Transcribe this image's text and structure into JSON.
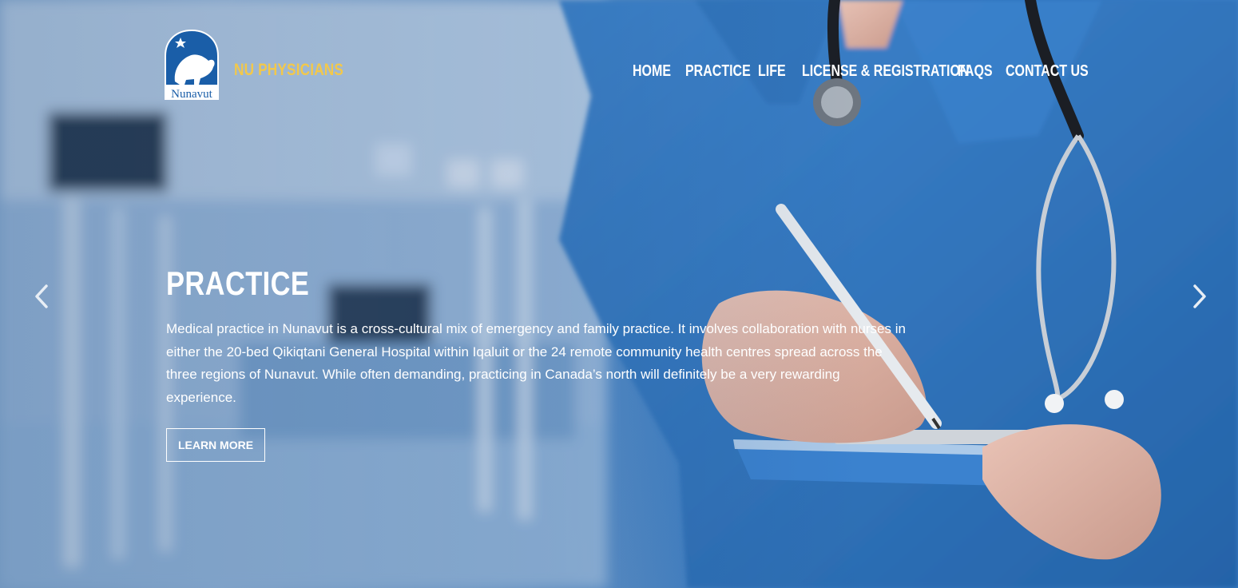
{
  "header": {
    "brand": "NU PHYSICIANS",
    "logo_text": "Nunavut",
    "nav": [
      {
        "label": "HOME"
      },
      {
        "label": "PRACTICE"
      },
      {
        "label": "LIFE"
      },
      {
        "label": "LICENSE & REGISTRATION"
      },
      {
        "label": "FAQS"
      },
      {
        "label": "CONTACT US"
      }
    ]
  },
  "slide": {
    "title": "PRACTICE",
    "description": "Medical practice in Nunavut is a cross-cultural mix of emergency and family practice. It involves collaboration with nurses in either the 20-bed Qikiqtani General Hospital within Iqaluit or the 24 remote community health centres spread across the three regions of Nunavut. While often demanding, practicing in Canada’s north will definitely be a very rewarding experience.",
    "button_label": "LEARN MORE"
  },
  "carousel": {
    "prev_icon": "chevron-left-icon",
    "next_icon": "chevron-right-icon"
  },
  "colors": {
    "brand": "#f2c84b",
    "logo_blue": "#1a5ea8",
    "scrubs": "#2f74bd"
  }
}
